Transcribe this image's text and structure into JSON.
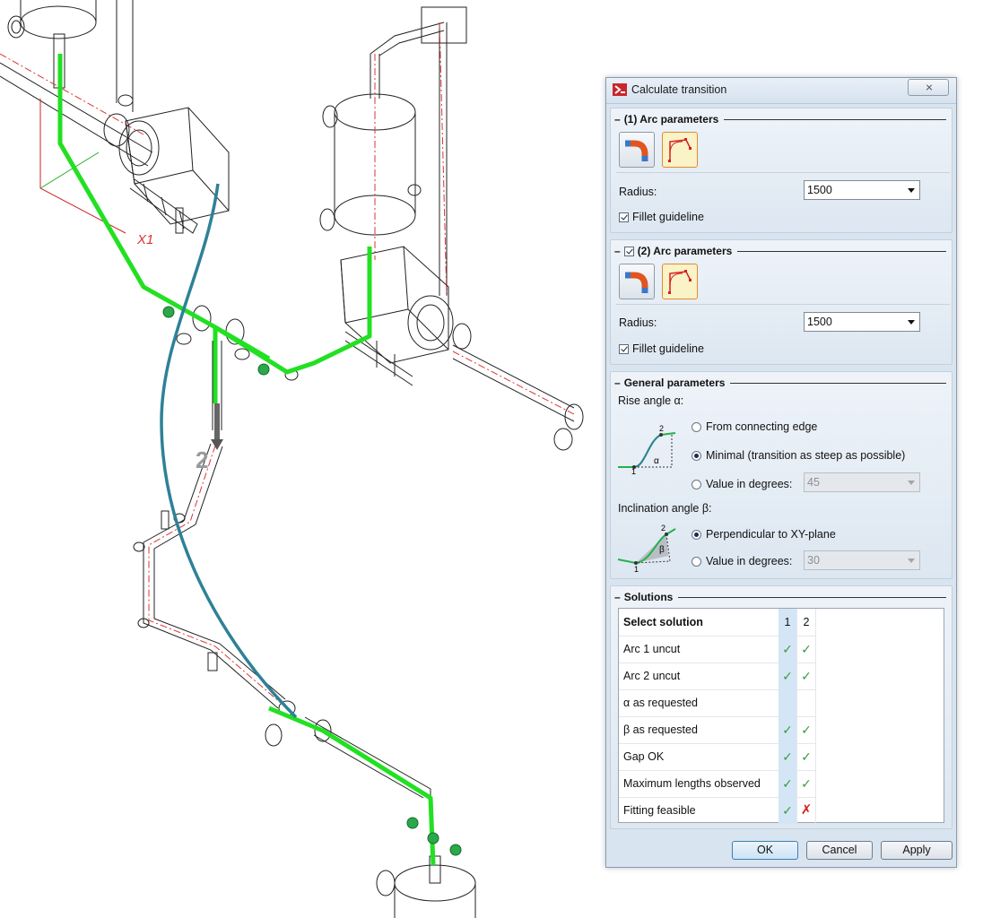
{
  "scene": {
    "labels": {
      "x1": "X1",
      "point2": "2"
    }
  },
  "dialog": {
    "title": "Calculate transition",
    "arc1": {
      "header": "(1) Arc parameters",
      "radius_label": "Radius:",
      "radius_value": "1500",
      "fillet_label": "Fillet guideline",
      "fillet_checked": true
    },
    "arc2": {
      "header": "(2) Arc parameters",
      "enabled": true,
      "radius_label": "Radius:",
      "radius_value": "1500",
      "fillet_label": "Fillet guideline",
      "fillet_checked": true
    },
    "general": {
      "header": "General parameters",
      "rise_label": "Rise angle α:",
      "rise_options": [
        "From connecting edge",
        "Minimal (transition as steep as possible)",
        "Value in degrees:"
      ],
      "rise_selected": 1,
      "rise_value": "45",
      "incl_label": "Inclination angle β:",
      "incl_options": [
        "Perpendicular to XY-plane",
        "Value in degrees:"
      ],
      "incl_selected": 0,
      "incl_value": "30",
      "diagram_labels": {
        "one": "1",
        "two": "2",
        "alpha": "α",
        "beta": "β"
      }
    },
    "solutions": {
      "header": "Solutions",
      "table_header": "Select solution",
      "col1": "1",
      "col2": "2",
      "rows": [
        {
          "name": "Arc 1 uncut",
          "s1": "ok",
          "s2": "ok"
        },
        {
          "name": "Arc 2 uncut",
          "s1": "ok",
          "s2": "ok"
        },
        {
          "name": "α as requested",
          "s1": "",
          "s2": ""
        },
        {
          "name": "β as requested",
          "s1": "ok",
          "s2": "ok"
        },
        {
          "name": "Gap OK",
          "s1": "ok",
          "s2": "ok"
        },
        {
          "name": "Maximum lengths observed",
          "s1": "ok",
          "s2": "ok"
        },
        {
          "name": "Fitting feasible",
          "s1": "ok",
          "s2": "fail"
        }
      ]
    },
    "buttons": {
      "ok": "OK",
      "cancel": "Cancel",
      "apply": "Apply"
    }
  }
}
